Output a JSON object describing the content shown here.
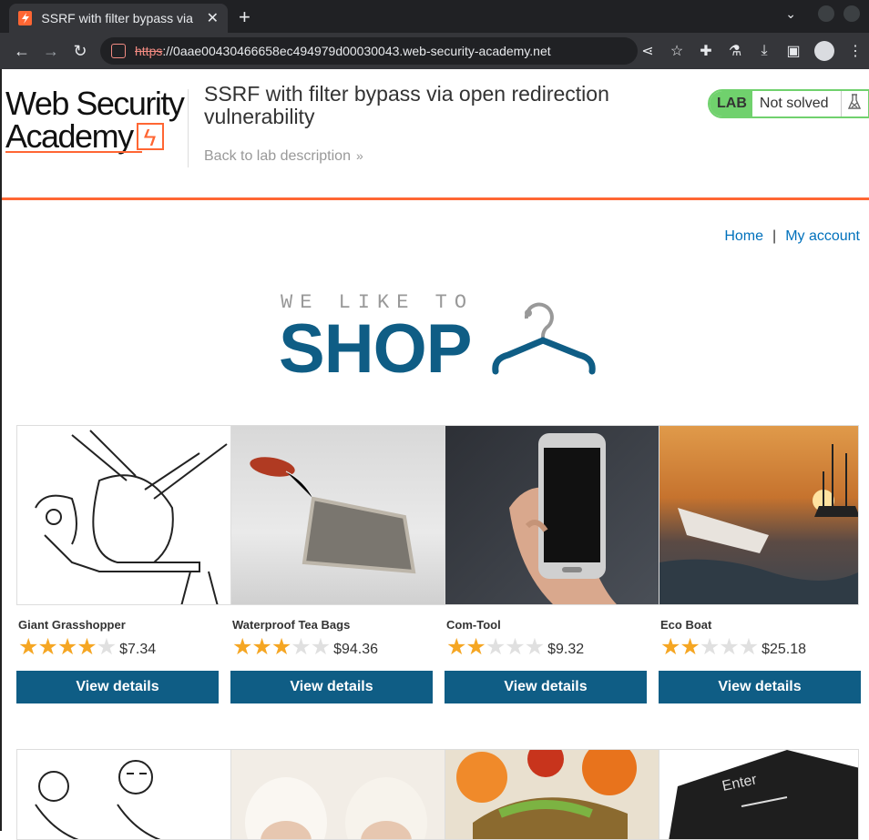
{
  "browser": {
    "tab_title": "SSRF with filter bypass via",
    "tab_close": "✕",
    "new_tab": "+",
    "url_scheme": "https",
    "url_rest": "://0aae00430466658ec494979d00030043.web-security-academy.net"
  },
  "header": {
    "logo_line1": "Web Security",
    "logo_line2": "Academy",
    "lab_title": "SSRF with filter bypass via open redirection vulnerability",
    "back_link": "Back to lab description",
    "back_chevron": "»",
    "lab_badge": "LAB",
    "lab_state": "Not solved"
  },
  "nav": {
    "home": "Home",
    "separator": "|",
    "account": "My account"
  },
  "shop_logo": {
    "sub": "WE LIKE TO",
    "main": "SHOP"
  },
  "products": [
    {
      "name": "Giant Grasshopper",
      "rating": 4,
      "price": "$7.34",
      "button": "View details"
    },
    {
      "name": "Waterproof Tea Bags",
      "rating": 3,
      "price": "$94.36",
      "button": "View details"
    },
    {
      "name": "Com-Tool",
      "rating": 2,
      "price": "$9.32",
      "button": "View details"
    },
    {
      "name": "Eco Boat",
      "rating": 2,
      "price": "$25.18",
      "button": "View details"
    }
  ],
  "colors": {
    "brand_orange": "#ff6633",
    "button_blue": "#0f5d85",
    "link_blue": "#0071bc",
    "lab_green": "#70d16d",
    "star": "#f5a623"
  }
}
